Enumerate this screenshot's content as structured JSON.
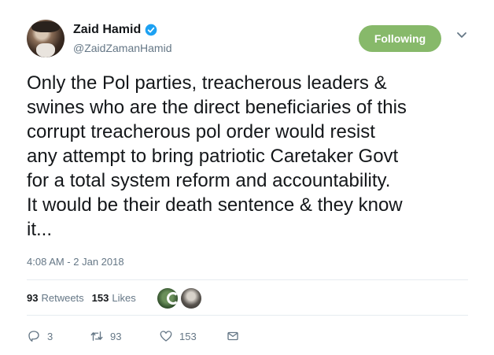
{
  "author": {
    "name": "Zaid Hamid",
    "handle": "@ZaidZamanHamid",
    "verified": true
  },
  "follow_button": {
    "label": "Following",
    "color": "#87b96a"
  },
  "tweet": {
    "lines": [
      "Only the Pol parties, treacherous leaders &",
      "swines who are the direct beneficiaries of this",
      "corrupt treacherous pol order would resist",
      "any attempt to bring patriotic Caretaker Govt",
      "for a total system reform and accountability.",
      "It would be their death sentence & they know",
      "it..."
    ],
    "timestamp": "4:08 AM - 2 Jan 2018"
  },
  "stats": {
    "retweets_count": "93",
    "retweets_label": "Retweets",
    "likes_count": "153",
    "likes_label": "Likes"
  },
  "actions": {
    "replies": "3",
    "retweets": "93",
    "likes": "153"
  },
  "icons": {
    "verified": "verified-badge-icon",
    "more": "chevron-down-icon",
    "reply": "reply-icon",
    "retweet": "retweet-icon",
    "like": "heart-icon",
    "message": "envelope-icon"
  },
  "colors": {
    "verified": "#1da1f2",
    "secondary_text": "#657786",
    "divider": "#e6ecf0"
  }
}
